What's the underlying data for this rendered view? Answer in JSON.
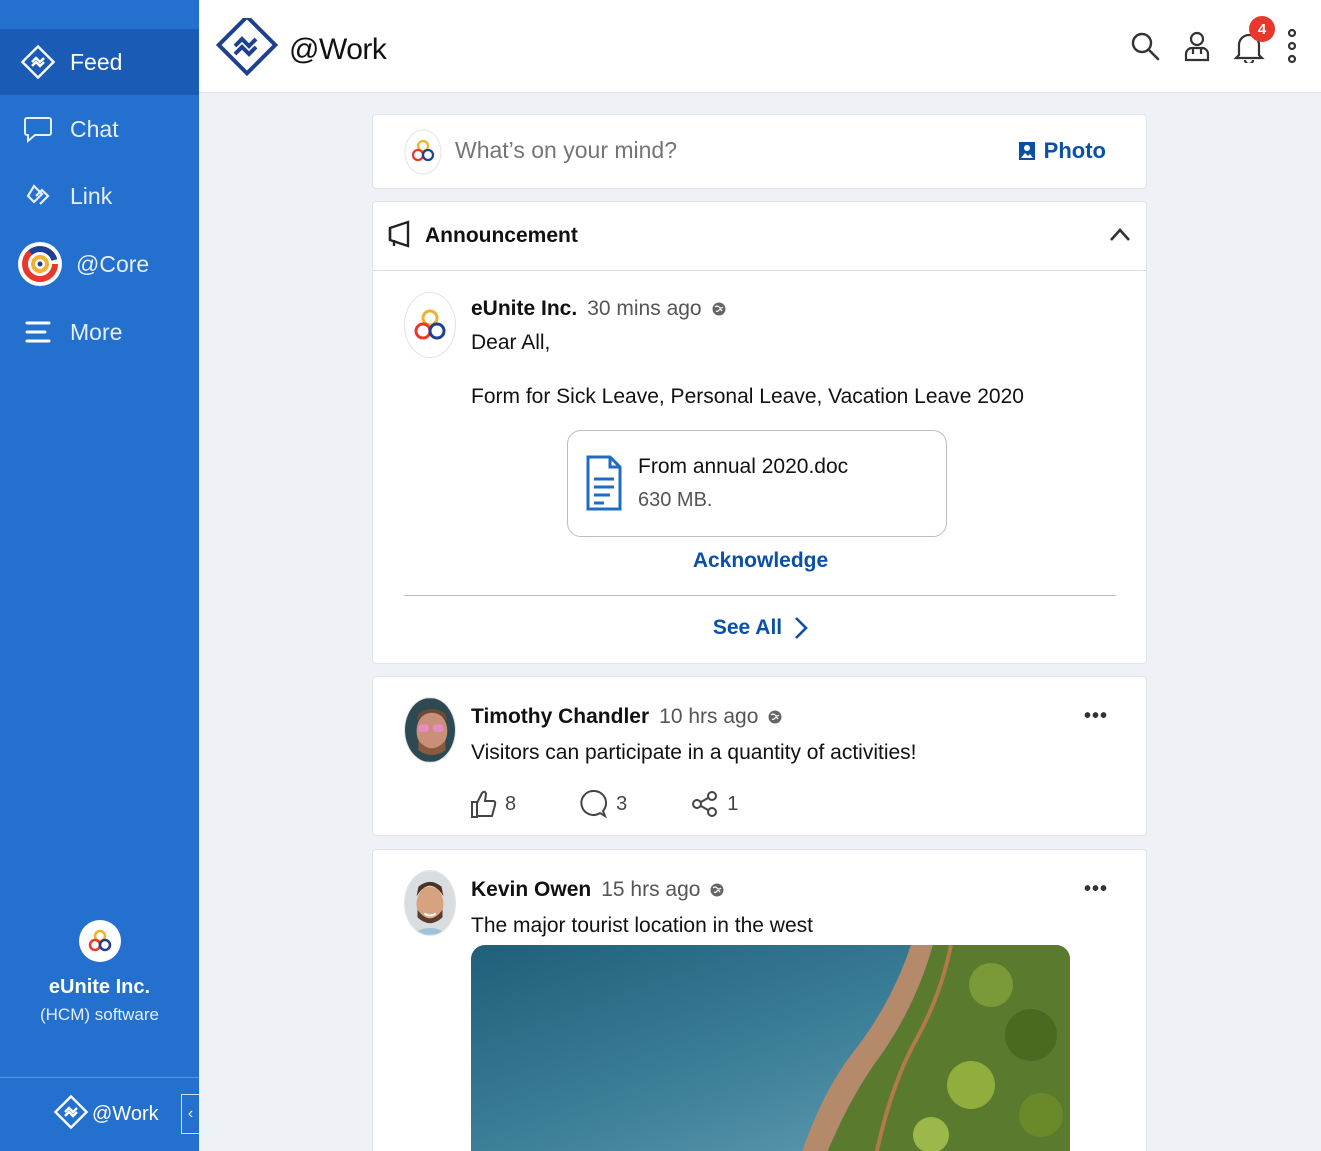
{
  "sidebar": {
    "items": [
      {
        "label": "Feed",
        "icon": "feed-logo-icon",
        "active": true
      },
      {
        "label": "Chat",
        "icon": "chat-bubble-icon"
      },
      {
        "label": "Link",
        "icon": "link-icon"
      },
      {
        "label": "@Core",
        "icon": "core-logo-icon"
      },
      {
        "label": "More",
        "icon": "hamburger-icon"
      }
    ],
    "org_name": "eUnite Inc.",
    "org_sub": "(HCM) software",
    "bottom_brand": "@Work"
  },
  "header": {
    "brand": "@Work",
    "notification_count": "4"
  },
  "composer": {
    "placeholder": "What’s on your mind?",
    "photo_label": "Photo"
  },
  "announcement": {
    "title": "Announcement",
    "author": "eUnite Inc.",
    "time": "30 mins ago",
    "greeting": "Dear All,",
    "body": "Form for Sick Leave, Personal Leave, Vacation Leave 2020",
    "file_name": "From annual 2020.doc",
    "file_size": "630 MB.",
    "acknowledge_label": "Acknowledge",
    "see_all_label": "See All"
  },
  "posts": [
    {
      "author": "Timothy Chandler",
      "time": "10 hrs ago",
      "text": "Visitors can participate in a quantity of activities!",
      "likes": "8",
      "comments": "3",
      "shares": "1"
    },
    {
      "author": "Kevin Owen",
      "time": "15 hrs ago",
      "text": "The major tourist location in the west"
    }
  ],
  "colors": {
    "sidebar": "#2470ce",
    "sidebar_active": "#1a5cb5",
    "link_blue": "#0a4fa8",
    "badge_red": "#e8382d"
  }
}
